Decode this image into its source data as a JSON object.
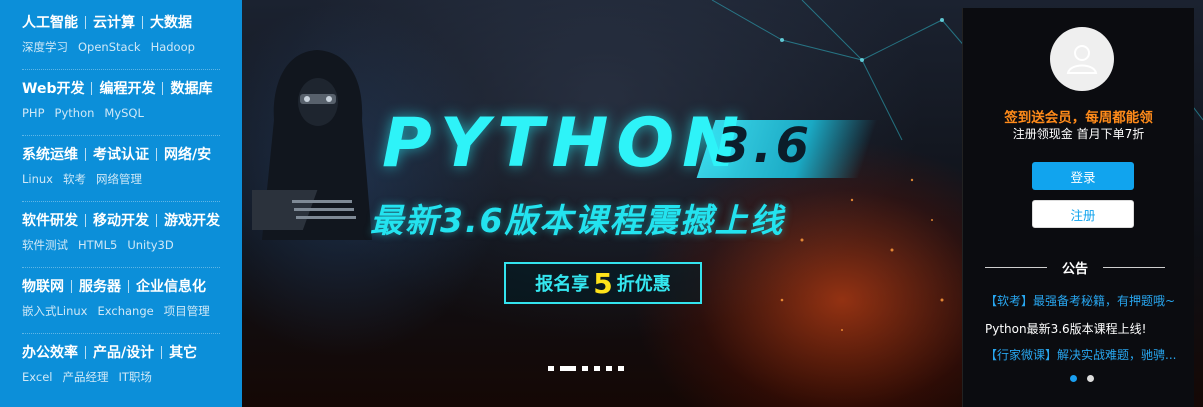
{
  "sidebar": {
    "groups": [
      {
        "main": [
          "人工智能",
          "云计算",
          "大数据"
        ],
        "sub": [
          "深度学习",
          "OpenStack",
          "Hadoop"
        ]
      },
      {
        "main": [
          "Web开发",
          "编程开发",
          "数据库"
        ],
        "sub": [
          "PHP",
          "Python",
          "MySQL"
        ]
      },
      {
        "main": [
          "系统运维",
          "考试认证",
          "网络/安"
        ],
        "sub": [
          "Linux",
          "软考",
          "网络管理"
        ]
      },
      {
        "main": [
          "软件研发",
          "移动开发",
          "游戏开发"
        ],
        "sub": [
          "软件测试",
          "HTML5",
          "Unity3D"
        ]
      },
      {
        "main": [
          "物联网",
          "服务器",
          "企业信息化"
        ],
        "sub": [
          "嵌入式Linux",
          "Exchange",
          "项目管理"
        ]
      },
      {
        "main": [
          "办公效率",
          "产品/设计",
          "其它"
        ],
        "sub": [
          "Excel",
          "产品经理",
          "IT职场"
        ]
      }
    ]
  },
  "banner": {
    "title": "PYTHON",
    "version": "3.6",
    "subtitle": "最新3.6版本课程震撼上线",
    "promo_prefix": "报名享",
    "promo_number": "5",
    "promo_suffix": "折优惠",
    "slide_count": 6,
    "active_slide": 1
  },
  "panel": {
    "avatar_icon": "user-avatar-icon",
    "promo_line": "签到送会员，每周都能领",
    "promo_sub": "注册领现金 首月下单7折",
    "login_label": "登录",
    "register_label": "注册",
    "notice_title": "公告",
    "notices": [
      "【软考】最强备考秘籍，有押题哦~",
      "Python最新3.6版本课程上线!",
      "【行家微课】解决实战难题，驰骋..."
    ],
    "notice_dot_active": 0
  },
  "colors": {
    "sidebar_bg": "#0c8fd9",
    "accent_cyan": "#2ef3f8",
    "promo_yellow": "#ffe31a",
    "promo_orange": "#ff8b1a",
    "button_blue": "#11a4ee",
    "notice_blue": "#28a6ef"
  }
}
